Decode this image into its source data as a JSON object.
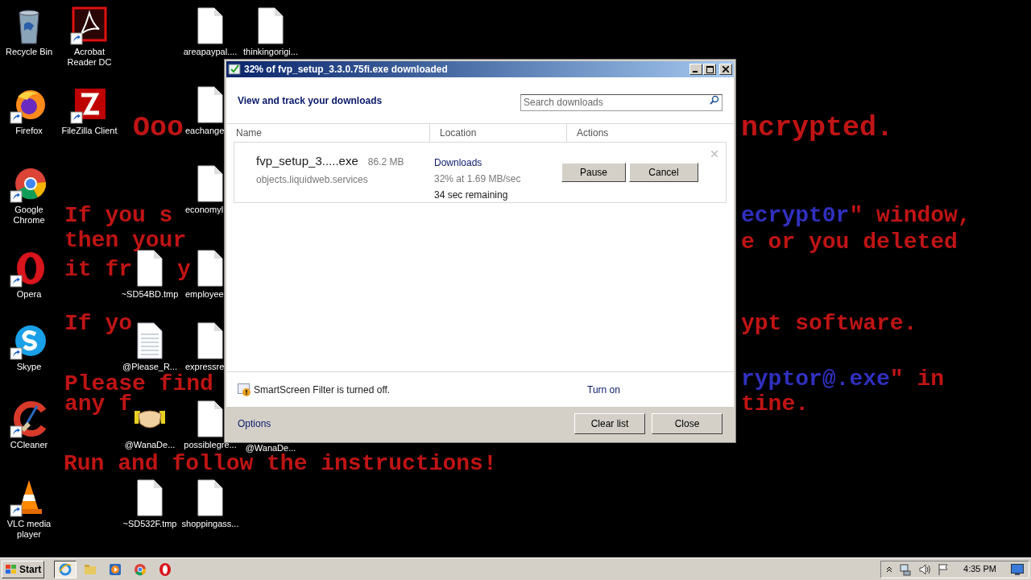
{
  "desktop": {
    "wallpaper_text": [
      {
        "parts": [
          {
            "text": "Ooo",
            "color": "#c01414"
          }
        ]
      },
      {
        "parts": [
          {
            "text": "ncrypted.",
            "color": "#c01414"
          }
        ]
      },
      {
        "parts": [
          {
            "text": "If you s",
            "color": "#c01414"
          }
        ]
      },
      {
        "parts": [
          {
            "text": "ecrypt0r",
            "color": "#3030c0"
          },
          {
            "text": "\" window,",
            "color": "#c01414"
          }
        ]
      },
      {
        "parts": [
          {
            "text": "then your",
            "color": "#c01414"
          }
        ]
      },
      {
        "parts": [
          {
            "text": "e or you deleted",
            "color": "#c01414"
          }
        ]
      },
      {
        "parts": [
          {
            "text": "it fr",
            "color": "#c01414"
          }
        ]
      },
      {
        "parts": [
          {
            "text": "y",
            "color": "#c01414"
          }
        ]
      },
      {
        "parts": [
          {
            "text": "If yo",
            "color": "#c01414"
          }
        ]
      },
      {
        "parts": [
          {
            "text": "ypt software.",
            "color": "#c01414"
          }
        ]
      },
      {
        "parts": [
          {
            "text": "Please find",
            "color": "#c01414"
          }
        ]
      },
      {
        "parts": [
          {
            "text": "ryptor@.exe",
            "color": "#3030c0"
          },
          {
            "text": "\" in",
            "color": "#c01414"
          }
        ]
      },
      {
        "parts": [
          {
            "text": "any f",
            "color": "#c01414"
          }
        ]
      },
      {
        "parts": [
          {
            "text": "tine.",
            "color": "#c01414"
          }
        ]
      },
      {
        "parts": [
          {
            "text": "Run and follow the instructions!",
            "color": "#c01414"
          }
        ]
      }
    ],
    "icons": [
      {
        "label": "Recycle Bin",
        "kind": "recycle",
        "shortcut": false
      },
      {
        "label": "Acrobat Reader DC",
        "kind": "acrobat",
        "shortcut": true
      },
      {
        "label": "areapaypal....",
        "kind": "file",
        "shortcut": false
      },
      {
        "label": "thinkingorigi...",
        "kind": "file",
        "shortcut": false
      },
      {
        "label": "Firefox",
        "kind": "firefox",
        "shortcut": true
      },
      {
        "label": "FileZilla Client",
        "kind": "filezilla",
        "shortcut": true
      },
      {
        "label": "eachange",
        "kind": "file",
        "shortcut": false
      },
      {
        "label": "Google Chrome",
        "kind": "chrome",
        "shortcut": true
      },
      {
        "label": "economyl",
        "kind": "file",
        "shortcut": false
      },
      {
        "label": "Opera",
        "kind": "opera",
        "shortcut": true
      },
      {
        "label": "~SD54BD.tmp",
        "kind": "file",
        "shortcut": false
      },
      {
        "label": "employee",
        "kind": "file",
        "shortcut": false
      },
      {
        "label": "Skype",
        "kind": "skype",
        "shortcut": true
      },
      {
        "label": "@Please_R...",
        "kind": "textfile",
        "shortcut": false
      },
      {
        "label": "expressre",
        "kind": "file",
        "shortcut": false
      },
      {
        "label": "CCleaner",
        "kind": "ccleaner",
        "shortcut": true
      },
      {
        "label": "@WanaDe...",
        "kind": "handshake",
        "shortcut": false
      },
      {
        "label": "possiblegre...",
        "kind": "file",
        "shortcut": false
      },
      {
        "label": "@WanaDe..."
      },
      {
        "label": "VLC media player",
        "kind": "vlc",
        "shortcut": true
      },
      {
        "label": "~SD532F.tmp",
        "kind": "file",
        "shortcut": false
      },
      {
        "label": "shoppingass...",
        "kind": "file",
        "shortcut": false
      }
    ]
  },
  "window": {
    "title": "32% of fvp_setup_3.3.0.75fi.exe downloaded",
    "heading": "View and track your downloads",
    "search": {
      "placeholder": "Search downloads"
    },
    "columns": [
      "Name",
      "Location",
      "Actions"
    ],
    "download": {
      "name": "fvp_setup_3.....exe",
      "size": "86.2 MB",
      "source": "objects.liquidweb.services",
      "location": "Downloads",
      "speed": "32% at 1.69 MB/sec",
      "remaining": "34 sec remaining",
      "buttons": [
        "Pause",
        "Cancel"
      ]
    },
    "smartscreen": {
      "message": "SmartScreen Filter is turned off.",
      "action": "Turn on"
    },
    "footer": {
      "link": "Options",
      "buttons": [
        "Clear list",
        "Close"
      ]
    }
  },
  "taskbar": {
    "start": "Start",
    "apps": [
      {
        "kind": "ie",
        "selected": true
      },
      {
        "kind": "folder",
        "selected": false
      },
      {
        "kind": "media",
        "selected": false
      },
      {
        "kind": "chrome",
        "selected": false
      },
      {
        "kind": "opera",
        "selected": false
      }
    ],
    "clock": "4:35 PM"
  }
}
